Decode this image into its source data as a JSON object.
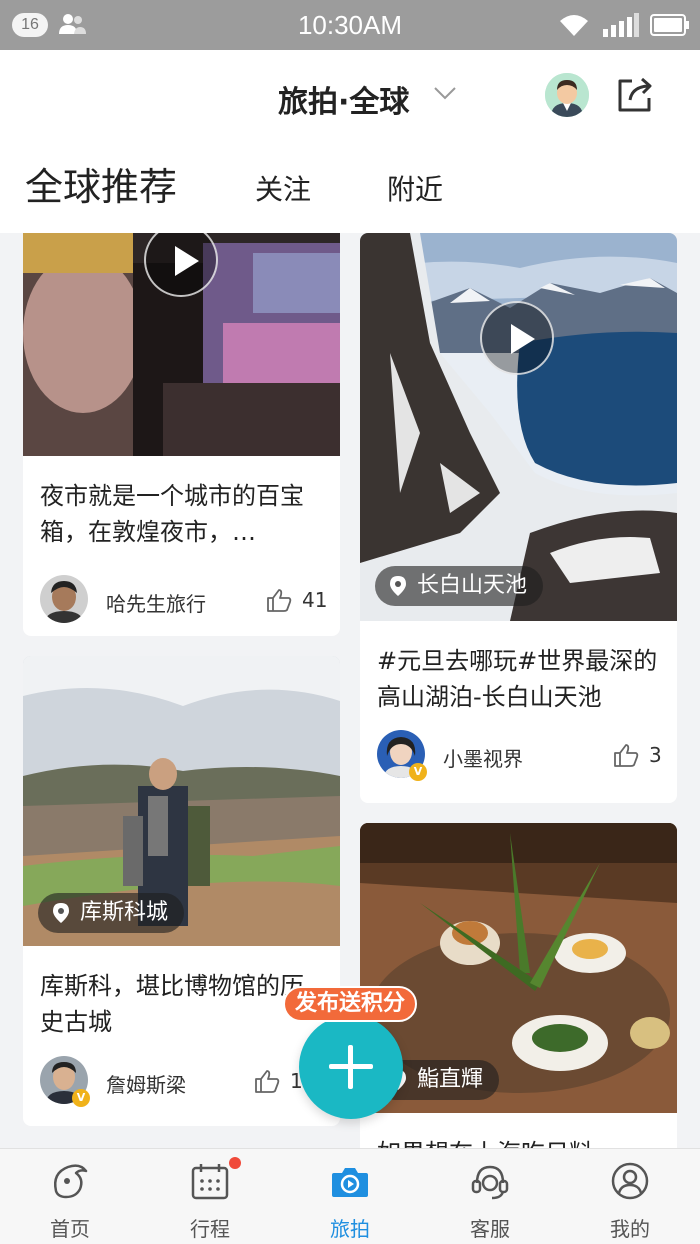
{
  "status_bar": {
    "badge": "16",
    "time": "10:30AM"
  },
  "header": {
    "title": "旅拍·全球"
  },
  "tabs": [
    {
      "label": "全球推荐",
      "active": true
    },
    {
      "label": "关注"
    },
    {
      "label": "附近"
    }
  ],
  "feed": {
    "cards": [
      {
        "text": "夜市就是一个城市的百宝箱，在敦煌夜市，…",
        "user": "哈先生旅行",
        "likes": "41",
        "video": true
      },
      {
        "text": "#元旦去哪玩#世界最深的高山湖泊-长白山天池",
        "location": "长白山天池",
        "user": "小墨视界",
        "likes": "3",
        "video": true,
        "verified": true
      },
      {
        "text": "库斯科，堪比博物馆的历史古城",
        "location": "库斯科城",
        "user": "詹姆斯梁",
        "likes": "1",
        "verified": true
      },
      {
        "text": "如果想在上海吃日料…",
        "location": "鮨直輝"
      }
    ]
  },
  "fab": {
    "tag": "发布送积分"
  },
  "bottom_nav": [
    {
      "label": "首页",
      "icon": "dolphin-icon"
    },
    {
      "label": "行程",
      "icon": "calendar-icon",
      "badge_dot": true
    },
    {
      "label": "旅拍",
      "icon": "camera-icon",
      "active": true
    },
    {
      "label": "客服",
      "icon": "headset-icon"
    },
    {
      "label": "我的",
      "icon": "profile-icon"
    }
  ],
  "colors": {
    "accent": "#1fb9a3",
    "active_nav": "#1f8fe0",
    "fab": "#1ab8c4",
    "fab_tag": "#f26a3a",
    "badge_dot": "#f04a3a",
    "status_bar": "#9c9c9c"
  }
}
